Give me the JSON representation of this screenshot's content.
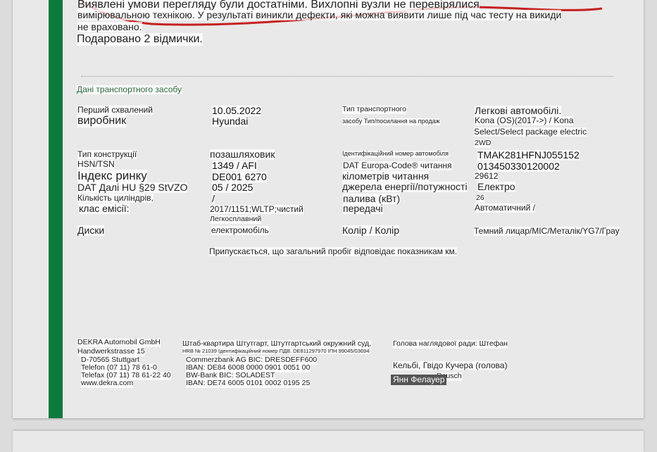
{
  "top_text": {
    "line1": "Виявлені умови перегляду були достатніми. Вихлопні вузли не перевірялися",
    "line2": "вимірювальною технікою. У результаті виникли дефекти, які можна виявити лише під час тесту на викиди",
    "line3": "не враховано.",
    "line4": "Подаровано 2 відмички."
  },
  "section_title": "Дані транспортного засобу",
  "vehicle": {
    "first_approved_label": "Перший схвалений",
    "first_approved_value": "10.05.2022",
    "manufacturer_label": "виробник",
    "manufacturer_value": "Hyundai",
    "vehicle_type_label": "Тип транспортного",
    "vehicle_type_label2": "засобу Тип/посилання на продаж",
    "vehicle_type_value1": "Легкові автомобілі.",
    "vehicle_type_value2": "Kona (OS)(2017->) / Kona",
    "vehicle_type_value3": "Select/Select package electric",
    "vehicle_type_value4": "2WD",
    "construction_label": "Тип конструкції",
    "construction_value": "позашляховик",
    "hsn_label": "HSN/TSN",
    "hsn_value": "1349 / AFI",
    "market_index_label": "Індекс ринку",
    "market_index_value": "DE001 6270",
    "dat_label": "DAT Далі HU §29 StVZO",
    "dat_value": "05 / 2025",
    "cylinders_label": "Кількість циліндрів,",
    "cylinders_value": "/",
    "emission_label": "клас емісії:",
    "emission_value": "2017/1151;WLTP;чистий",
    "light_alloy": "Легкосплавний",
    "wheels_label": "Диски",
    "wheels_value": "електромобіль",
    "vin_label": "Ідентифікаційний номер автомобіля",
    "vin_value": "TMAK281HFNJ055152",
    "dat_code_label": "DAT Europa-Code® читання",
    "dat_code_value": "013450330120002",
    "mileage_label": "кілометрів читання",
    "mileage_value": "29612",
    "energy_label": "джерела енергії/потужності",
    "energy_value": "Електро",
    "fuel_label": "палива (кВт)",
    "fuel_value": "26",
    "transmission_label": "передачі",
    "transmission_value": "Автоматичний /",
    "color_label": "Колір / Колір",
    "color_value": "Темний лицар/MIC/Металік/YG7/Грау",
    "mileage_note": "Припускається, що загальний пробіг відповідає показникам км."
  },
  "footer": {
    "col1": [
      "DEKRA Automobil GmbH",
      "Handwerkstrasse 15",
      "D-70565 Stuttgart",
      "Telefon (07 11) 78 61-0",
      "Telefax (07 11) 78 61-22 40",
      "www.dekra.com"
    ],
    "col2_title": "Штаб-квартира Штутгарт, Штутгартський окружний суд,",
    "col2_sub": "HRB № 21039 Ідентифікаційний номер ПДВ. DE811297970 ІПН 99045/03694",
    "col2": [
      "Commerzbank AG  BIC: DRESDEFF600",
      "IBAN: DE84 6008 0000 0901 0051 00",
      "BW-Bank  BIC: SOLADEST",
      "IBAN: DE74 6005 0101 0002 0195 25"
    ],
    "col3_title": "Голова наглядової ради: Штефан",
    "col3_line1": "Кельбі, Гвідо Кучера (голова)",
    "col3_line2": "Rausch",
    "col3_name": "Янн Фелауер"
  }
}
